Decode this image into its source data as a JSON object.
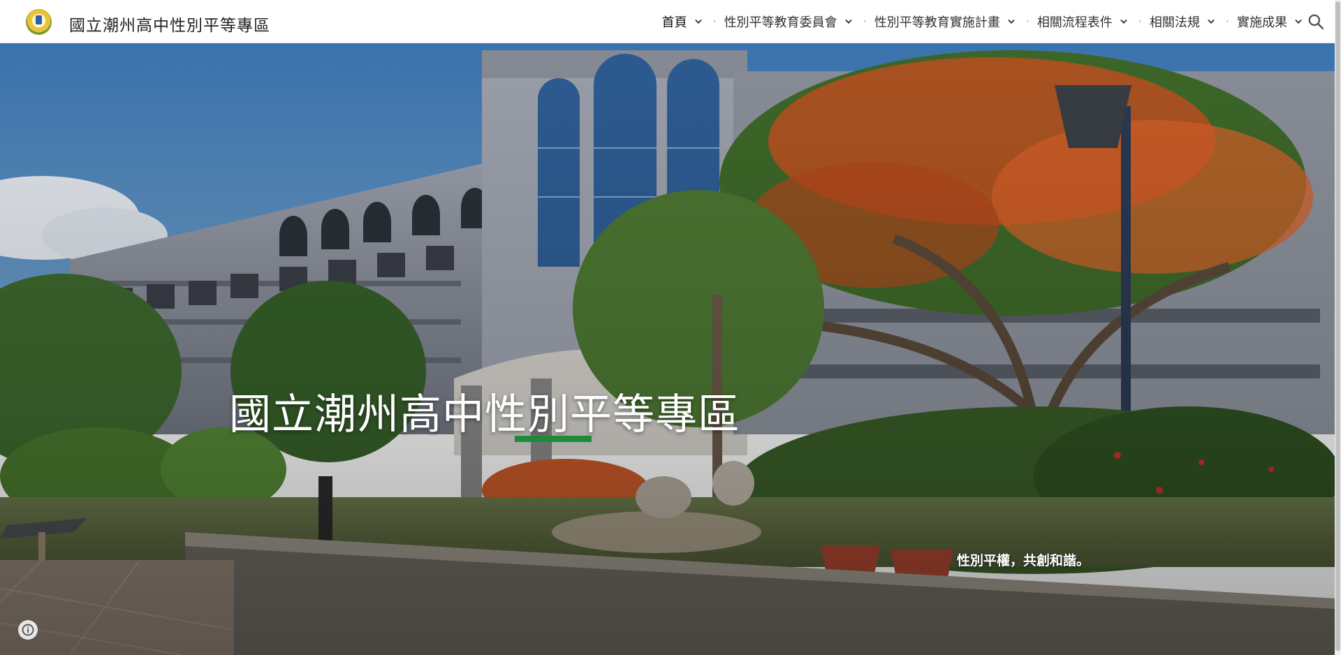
{
  "header": {
    "site_title": "國立潮州高中性別平等專區",
    "nav": [
      {
        "label": "首頁",
        "active": true
      },
      {
        "label": "性別平等教育委員會"
      },
      {
        "label": "性別平等教育實施計畫"
      },
      {
        "label": "相關流程表件"
      },
      {
        "label": "相關法規"
      },
      {
        "label": "實施成果"
      }
    ],
    "separator": "·",
    "search_icon": "search-icon"
  },
  "hero": {
    "title": "國立潮州高中性別平等專區",
    "subtitle": "性別平權，共創和諧。",
    "accent_color": "#1e8a3c"
  },
  "footer": {
    "info_icon": "info-icon"
  }
}
